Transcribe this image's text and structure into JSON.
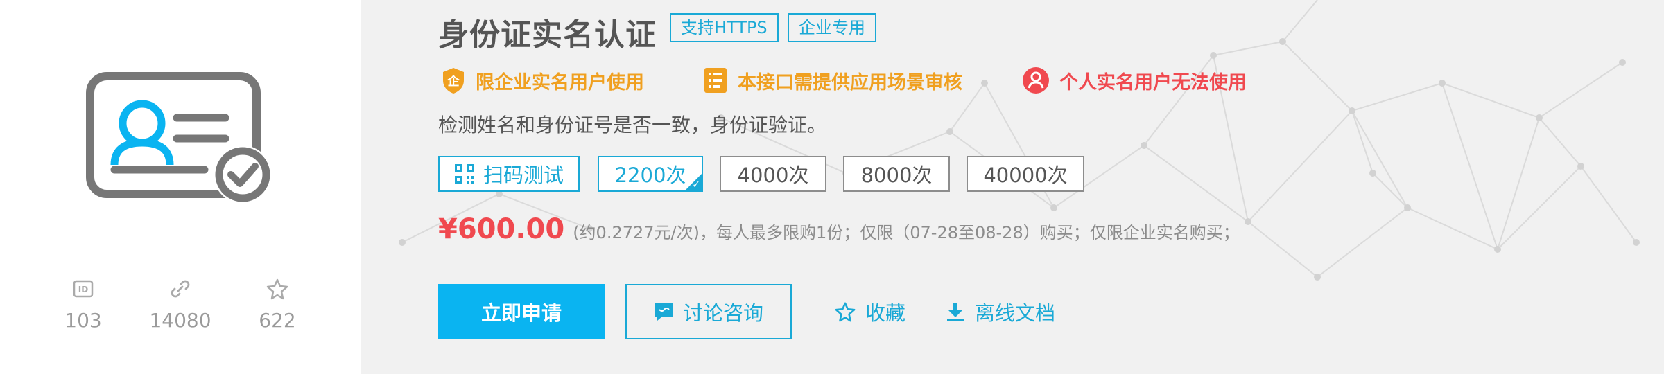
{
  "title": "身份证实名认证",
  "tags": [
    "支持HTTPS",
    "企业专用"
  ],
  "notices": [
    {
      "icon": "enterprise-badge-icon",
      "text": "限企业实名用户使用",
      "color": "#f0a020"
    },
    {
      "icon": "document-list-icon",
      "text": "本接口需提供应用场景审核",
      "color": "#f0a020"
    },
    {
      "icon": "person-restricted-icon",
      "text": "个人实名用户无法使用",
      "color": "#f0494f"
    }
  ],
  "description": "检测姓名和身份证号是否一致，身份证验证。",
  "scan_button": {
    "label": "扫码测试",
    "icon": "qrcode-icon"
  },
  "packages": [
    {
      "label": "2200次",
      "selected": true
    },
    {
      "label": "4000次",
      "selected": false
    },
    {
      "label": "8000次",
      "selected": false
    },
    {
      "label": "40000次",
      "selected": false
    }
  ],
  "price": "¥600.00",
  "price_note": "(约0.2727元/次)，每人最多限购1份；仅限（07-28至08-28）购买；仅限企业实名购买；",
  "actions": {
    "apply": "立即申请",
    "consult": "讨论咨询",
    "favorite": "收藏",
    "download_docs": "离线文档"
  },
  "stats": [
    {
      "icon": "id-icon",
      "value": "103"
    },
    {
      "icon": "link-icon",
      "value": "14080"
    },
    {
      "icon": "star-icon",
      "value": "622"
    }
  ],
  "colors": {
    "accent": "#1aa9d6",
    "primary_button": "#0ab4f1",
    "price": "#f0494f",
    "warning": "#f0a020",
    "danger": "#f0494f",
    "icon_gray": "#777777"
  }
}
